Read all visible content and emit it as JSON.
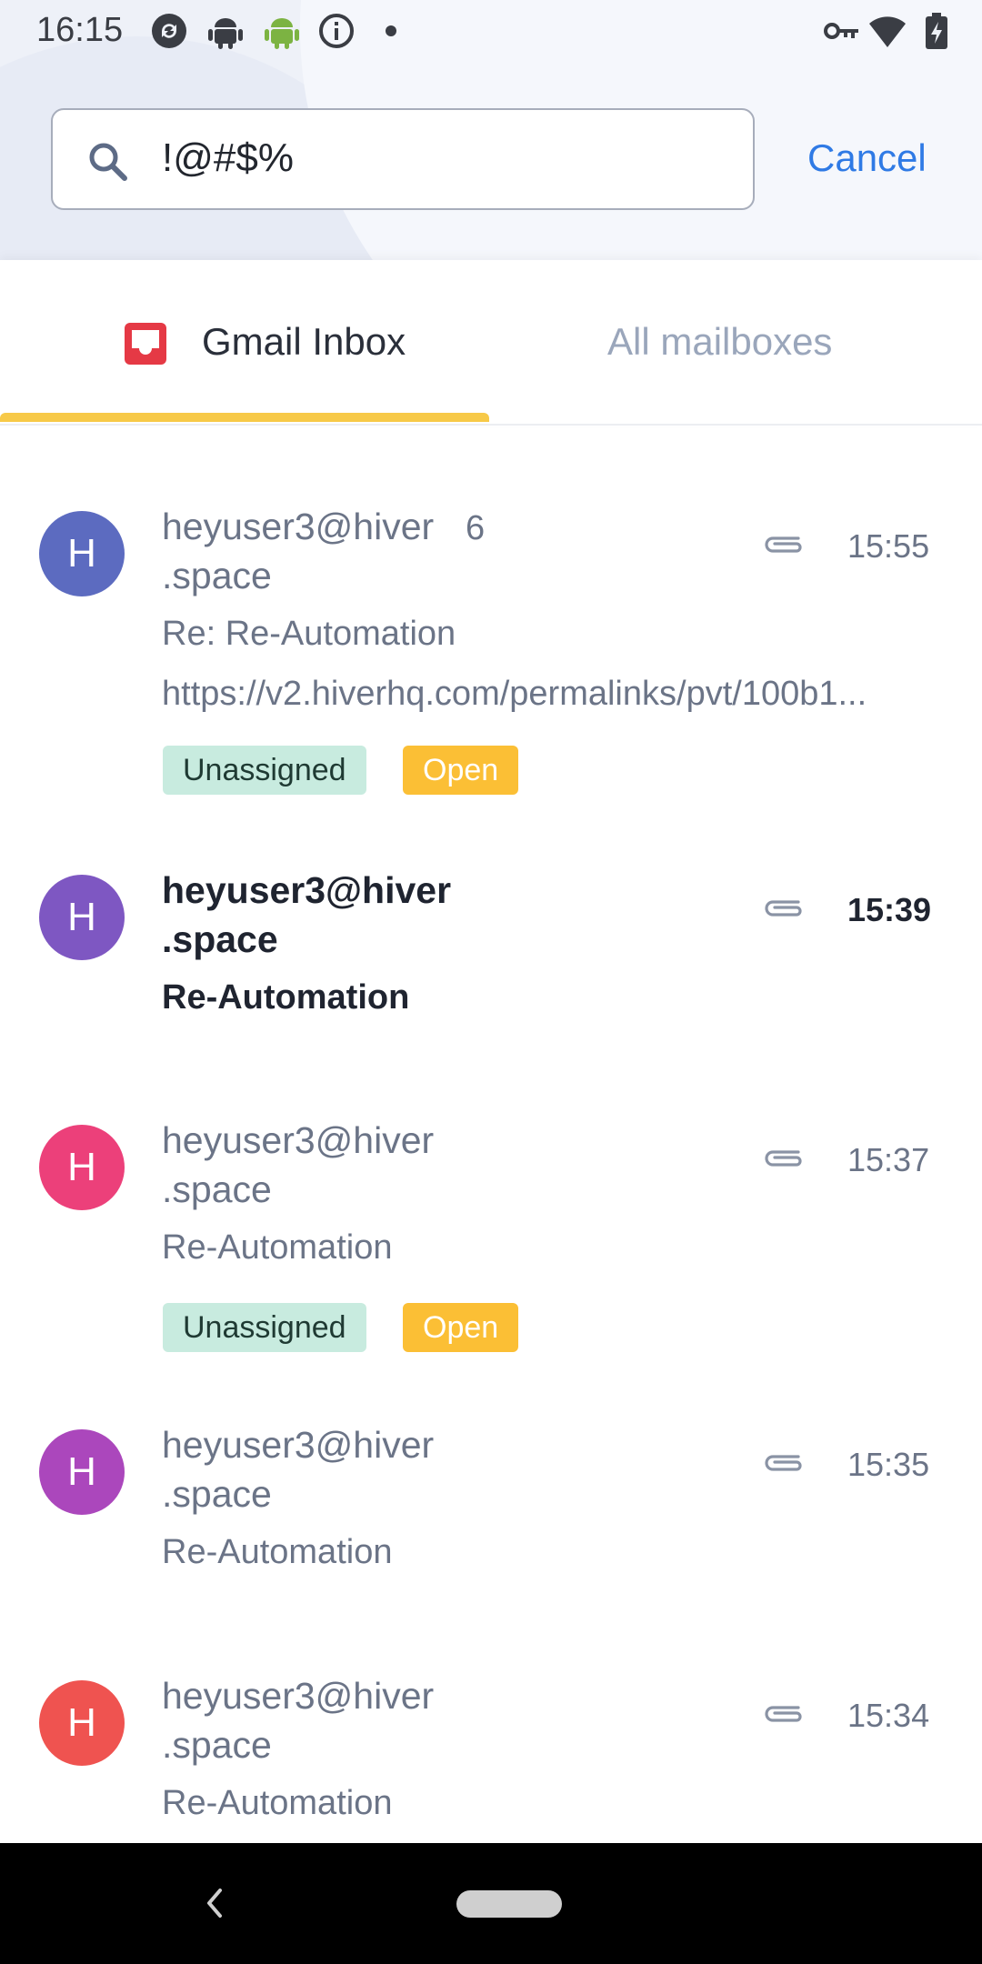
{
  "status_bar": {
    "time": "16:15",
    "icons": [
      "sync-icon",
      "android-icon",
      "android-green-icon",
      "info-icon",
      "dot-icon",
      "key-icon",
      "wifi-icon",
      "battery-icon"
    ]
  },
  "search": {
    "query": "!@#$%",
    "cancel_label": "Cancel"
  },
  "tabs": {
    "gmail_label": "Gmail Inbox",
    "all_label": "All mailboxes",
    "active_color": "#f7c948"
  },
  "emails": [
    {
      "initial": "H",
      "avatar_color": "#5c6bc0",
      "sender_line1": "heyuser3@hiver",
      "sender_line2": ".space",
      "count": "6",
      "time": "15:55",
      "subject": "Re: Re-Automation",
      "snippet": "https://v2.hiverhq.com/permalinks/pvt/100b1...",
      "tag_assign": "Unassigned",
      "tag_status": "Open"
    },
    {
      "initial": "H",
      "avatar_color": "#7e57c2",
      "sender_line1": "heyuser3@hiver",
      "sender_line2": ".space",
      "time": "15:39",
      "subject": "Re-Automation"
    },
    {
      "initial": "H",
      "avatar_color": "#ec407a",
      "sender_line1": "heyuser3@hiver",
      "sender_line2": ".space",
      "time": "15:37",
      "subject": "Re-Automation",
      "tag_assign": "Unassigned",
      "tag_status": "Open"
    },
    {
      "initial": "H",
      "avatar_color": "#ab47bc",
      "sender_line1": "heyuser3@hiver",
      "sender_line2": ".space",
      "time": "15:35",
      "subject": "Re-Automation"
    },
    {
      "initial": "H",
      "avatar_color": "#ef5350",
      "sender_line1": "heyuser3@hiver",
      "sender_line2": ".space",
      "time": "15:34",
      "subject": "Re-Automation"
    }
  ]
}
